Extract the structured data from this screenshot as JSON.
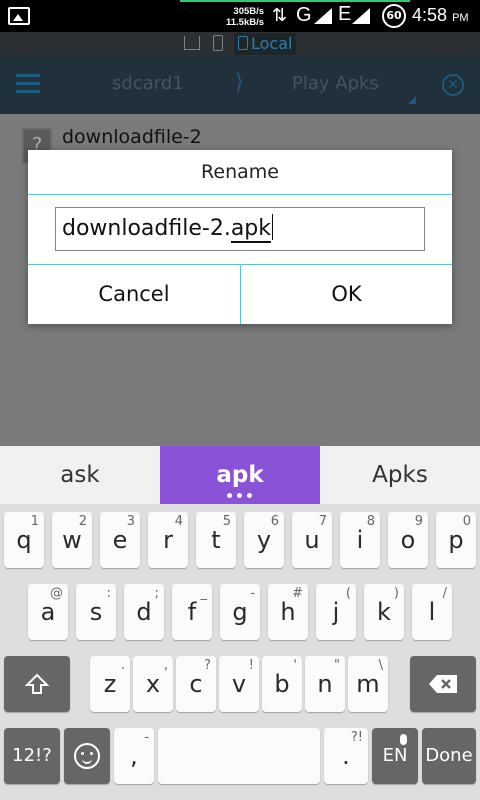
{
  "status_bar": {
    "speed_up": "305B/s",
    "speed_down": "11.5kB/s",
    "network_1": "G",
    "network_2": "E",
    "battery": "60",
    "time": "4:58",
    "ampm": "PM"
  },
  "location_bar": {
    "active_label": "Local"
  },
  "toolbar": {
    "crumb_1": "sdcard1",
    "crumb_sep": "⟩",
    "crumb_2": "Play Apks",
    "close": "✕"
  },
  "file_list": {
    "items": [
      {
        "name": "downloadfile-2",
        "icon": "?"
      }
    ]
  },
  "dialog": {
    "title": "Rename",
    "input_value_prefix": "downloadfile-2.",
    "input_value_underlined": "apk",
    "cancel_label": "Cancel",
    "ok_label": "OK"
  },
  "suggestions": {
    "left": "ask",
    "center": "apk",
    "center_more": "•••",
    "right": "Apks"
  },
  "keyboard": {
    "row1": [
      {
        "k": "q",
        "h": "1"
      },
      {
        "k": "w",
        "h": "2"
      },
      {
        "k": "e",
        "h": "3"
      },
      {
        "k": "r",
        "h": "4"
      },
      {
        "k": "t",
        "h": "5"
      },
      {
        "k": "y",
        "h": "6"
      },
      {
        "k": "u",
        "h": "7"
      },
      {
        "k": "i",
        "h": "8"
      },
      {
        "k": "o",
        "h": "9"
      },
      {
        "k": "p",
        "h": "0"
      }
    ],
    "row2": [
      {
        "k": "a",
        "h": "@"
      },
      {
        "k": "s",
        "h": ":"
      },
      {
        "k": "d",
        "h": ";"
      },
      {
        "k": "f",
        "h": "_"
      },
      {
        "k": "g",
        "h": "-"
      },
      {
        "k": "h",
        "h": "#"
      },
      {
        "k": "j",
        "h": "("
      },
      {
        "k": "k",
        "h": ")"
      },
      {
        "k": "l",
        "h": "/"
      }
    ],
    "row3": [
      {
        "k": "z",
        "h": "."
      },
      {
        "k": "x",
        "h": ","
      },
      {
        "k": "c",
        "h": "?"
      },
      {
        "k": "v",
        "h": "!"
      },
      {
        "k": "b",
        "h": "'"
      },
      {
        "k": "n",
        "h": "\""
      },
      {
        "k": "m",
        "h": "\\"
      }
    ],
    "symbols_label": "12!?",
    "comma_label": ",",
    "comma_hint": "-",
    "period_label": ".",
    "period_hint": "?!",
    "lang_label": "EN",
    "done_label": "Done"
  },
  "colors": {
    "dialog_divider": "#5cc3d6",
    "suggestion_highlight": "#8a52d6",
    "toolbar_bg": "#21313b"
  },
  "icons": {
    "status_left": "gallery-icon",
    "location": [
      "home-icon",
      "phone-icon",
      "device-icon"
    ],
    "toolbar": [
      "menu-icon",
      "close-circle-icon"
    ],
    "keyboard": [
      "shift-icon",
      "backspace-icon",
      "emoji-icon",
      "mic-icon"
    ]
  }
}
